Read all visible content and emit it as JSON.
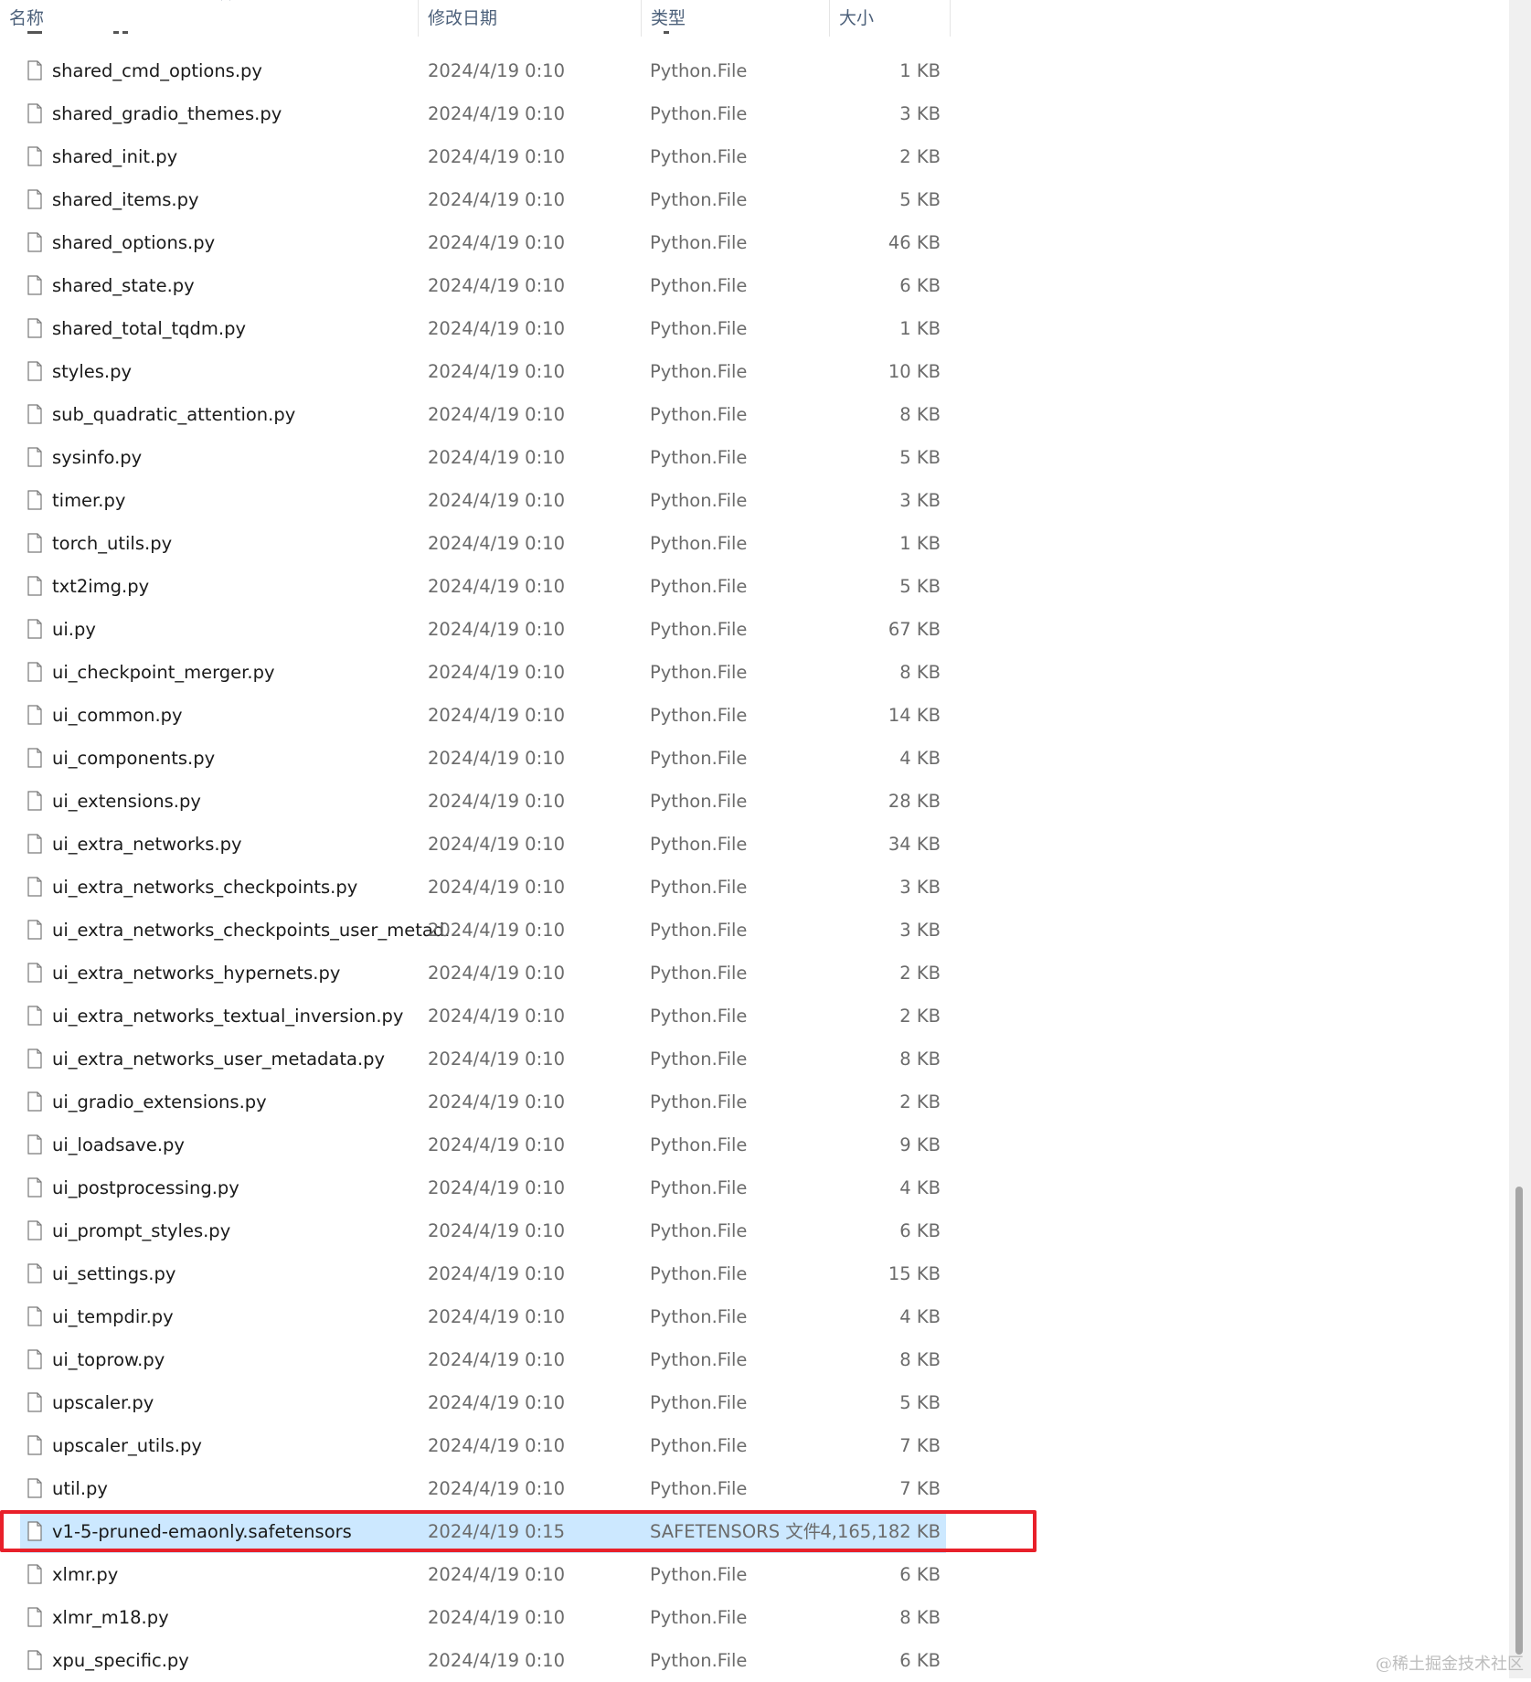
{
  "header": {
    "name": "名称",
    "modified": "修改日期",
    "type": "类型",
    "size": "大小",
    "sort_icon": "chevron-up-icon"
  },
  "icons": {
    "file": "file-icon"
  },
  "files": [
    {
      "name": "shared_cmd_options.py",
      "date": "2024/4/19 0:10",
      "type": "Python.File",
      "size": "1 KB"
    },
    {
      "name": "shared_gradio_themes.py",
      "date": "2024/4/19 0:10",
      "type": "Python.File",
      "size": "3 KB"
    },
    {
      "name": "shared_init.py",
      "date": "2024/4/19 0:10",
      "type": "Python.File",
      "size": "2 KB"
    },
    {
      "name": "shared_items.py",
      "date": "2024/4/19 0:10",
      "type": "Python.File",
      "size": "5 KB"
    },
    {
      "name": "shared_options.py",
      "date": "2024/4/19 0:10",
      "type": "Python.File",
      "size": "46 KB"
    },
    {
      "name": "shared_state.py",
      "date": "2024/4/19 0:10",
      "type": "Python.File",
      "size": "6 KB"
    },
    {
      "name": "shared_total_tqdm.py",
      "date": "2024/4/19 0:10",
      "type": "Python.File",
      "size": "1 KB"
    },
    {
      "name": "styles.py",
      "date": "2024/4/19 0:10",
      "type": "Python.File",
      "size": "10 KB"
    },
    {
      "name": "sub_quadratic_attention.py",
      "date": "2024/4/19 0:10",
      "type": "Python.File",
      "size": "8 KB"
    },
    {
      "name": "sysinfo.py",
      "date": "2024/4/19 0:10",
      "type": "Python.File",
      "size": "5 KB"
    },
    {
      "name": "timer.py",
      "date": "2024/4/19 0:10",
      "type": "Python.File",
      "size": "3 KB"
    },
    {
      "name": "torch_utils.py",
      "date": "2024/4/19 0:10",
      "type": "Python.File",
      "size": "1 KB"
    },
    {
      "name": "txt2img.py",
      "date": "2024/4/19 0:10",
      "type": "Python.File",
      "size": "5 KB"
    },
    {
      "name": "ui.py",
      "date": "2024/4/19 0:10",
      "type": "Python.File",
      "size": "67 KB"
    },
    {
      "name": "ui_checkpoint_merger.py",
      "date": "2024/4/19 0:10",
      "type": "Python.File",
      "size": "8 KB"
    },
    {
      "name": "ui_common.py",
      "date": "2024/4/19 0:10",
      "type": "Python.File",
      "size": "14 KB"
    },
    {
      "name": "ui_components.py",
      "date": "2024/4/19 0:10",
      "type": "Python.File",
      "size": "4 KB"
    },
    {
      "name": "ui_extensions.py",
      "date": "2024/4/19 0:10",
      "type": "Python.File",
      "size": "28 KB"
    },
    {
      "name": "ui_extra_networks.py",
      "date": "2024/4/19 0:10",
      "type": "Python.File",
      "size": "34 KB"
    },
    {
      "name": "ui_extra_networks_checkpoints.py",
      "date": "2024/4/19 0:10",
      "type": "Python.File",
      "size": "3 KB"
    },
    {
      "name": "ui_extra_networks_checkpoints_user_metad...",
      "date": "2024/4/19 0:10",
      "type": "Python.File",
      "size": "3 KB"
    },
    {
      "name": "ui_extra_networks_hypernets.py",
      "date": "2024/4/19 0:10",
      "type": "Python.File",
      "size": "2 KB"
    },
    {
      "name": "ui_extra_networks_textual_inversion.py",
      "date": "2024/4/19 0:10",
      "type": "Python.File",
      "size": "2 KB"
    },
    {
      "name": "ui_extra_networks_user_metadata.py",
      "date": "2024/4/19 0:10",
      "type": "Python.File",
      "size": "8 KB"
    },
    {
      "name": "ui_gradio_extensions.py",
      "date": "2024/4/19 0:10",
      "type": "Python.File",
      "size": "2 KB"
    },
    {
      "name": "ui_loadsave.py",
      "date": "2024/4/19 0:10",
      "type": "Python.File",
      "size": "9 KB"
    },
    {
      "name": "ui_postprocessing.py",
      "date": "2024/4/19 0:10",
      "type": "Python.File",
      "size": "4 KB"
    },
    {
      "name": "ui_prompt_styles.py",
      "date": "2024/4/19 0:10",
      "type": "Python.File",
      "size": "6 KB"
    },
    {
      "name": "ui_settings.py",
      "date": "2024/4/19 0:10",
      "type": "Python.File",
      "size": "15 KB"
    },
    {
      "name": "ui_tempdir.py",
      "date": "2024/4/19 0:10",
      "type": "Python.File",
      "size": "4 KB"
    },
    {
      "name": "ui_toprow.py",
      "date": "2024/4/19 0:10",
      "type": "Python.File",
      "size": "8 KB"
    },
    {
      "name": "upscaler.py",
      "date": "2024/4/19 0:10",
      "type": "Python.File",
      "size": "5 KB"
    },
    {
      "name": "upscaler_utils.py",
      "date": "2024/4/19 0:10",
      "type": "Python.File",
      "size": "7 KB"
    },
    {
      "name": "util.py",
      "date": "2024/4/19 0:10",
      "type": "Python.File",
      "size": "7 KB"
    },
    {
      "name": "v1-5-pruned-emaonly.safetensors",
      "date": "2024/4/19 0:15",
      "type": "SAFETENSORS 文件",
      "size": "4,165,182 KB",
      "selected": true,
      "highlighted": true
    },
    {
      "name": "xlmr.py",
      "date": "2024/4/19 0:10",
      "type": "Python.File",
      "size": "6 KB"
    },
    {
      "name": "xlmr_m18.py",
      "date": "2024/4/19 0:10",
      "type": "Python.File",
      "size": "8 KB"
    },
    {
      "name": "xpu_specific.py",
      "date": "2024/4/19 0:10",
      "type": "Python.File",
      "size": "6 KB"
    }
  ],
  "colors": {
    "selection_bg": "#cce8ff",
    "highlight_border": "#e8202a",
    "header_text": "#4c607a",
    "secondary_text": "#6b6b6b"
  },
  "watermark": "@稀土掘金技术社区"
}
